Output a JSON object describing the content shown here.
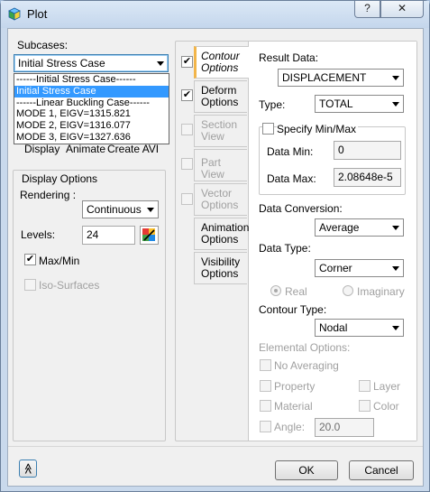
{
  "window": {
    "title": "Plot",
    "help_label": "?",
    "close_label": "✕"
  },
  "subcases": {
    "label": "Subcases:",
    "selected": "Initial Stress Case",
    "options": [
      "------Initial Stress Case------",
      "Initial Stress Case",
      "------Linear Buckling Case------",
      "MODE 1, EIGV=1315.821",
      "MODE 2, EIGV=1316.077",
      "MODE 3, EIGV=1327.636"
    ],
    "hidden_actions": [
      "Display",
      "Animate",
      "Create AVI"
    ]
  },
  "display_options": {
    "title": "Display Options",
    "rendering_label": "Rendering :",
    "rendering_value": "Continuous",
    "levels_label": "Levels:",
    "levels_value": "24",
    "maxmin_label": "Max/Min",
    "maxmin_checked": true,
    "iso_label": "Iso-Surfaces",
    "iso_checked": false
  },
  "tabs": [
    {
      "label": "Contour Options",
      "checked": true,
      "enabled": true,
      "active": true
    },
    {
      "label": "Deform Options",
      "checked": true,
      "enabled": true,
      "active": false
    },
    {
      "label": "Section View",
      "checked": false,
      "enabled": false,
      "active": false
    },
    {
      "label": "Part View",
      "checked": false,
      "enabled": false,
      "active": false
    },
    {
      "label": "Vector Options",
      "checked": false,
      "enabled": false,
      "active": false
    },
    {
      "label": "Animation Options",
      "enabled": true,
      "active": false
    },
    {
      "label": "Visibility Options",
      "enabled": true,
      "active": false
    }
  ],
  "contour": {
    "result_data_label": "Result Data:",
    "result_data_value": "DISPLACEMENT",
    "type_label": "Type:",
    "type_value": "TOTAL",
    "specify_minmax_label": "Specify Min/Max",
    "data_min_label": "Data Min:",
    "data_min_value": "0",
    "data_max_label": "Data Max:",
    "data_max_value": "2.08648e-5",
    "data_conversion_label": "Data Conversion:",
    "data_conversion_value": "Average",
    "data_type_label": "Data Type:",
    "data_type_value": "Corner",
    "real_label": "Real",
    "imaginary_label": "Imaginary",
    "contour_type_label": "Contour Type:",
    "contour_type_value": "Nodal",
    "elemental_options_label": "Elemental Options:",
    "no_averaging_label": "No Averaging",
    "property_label": "Property",
    "layer_label": "Layer",
    "material_label": "Material",
    "color_label": "Color",
    "angle_label": "Angle:",
    "angle_value": "20.0"
  },
  "footer": {
    "ok_label": "OK",
    "cancel_label": "Cancel",
    "expand_label": "≪"
  },
  "colors": {
    "accent": "#3399ff",
    "tab_marker": "#f2b54a"
  }
}
